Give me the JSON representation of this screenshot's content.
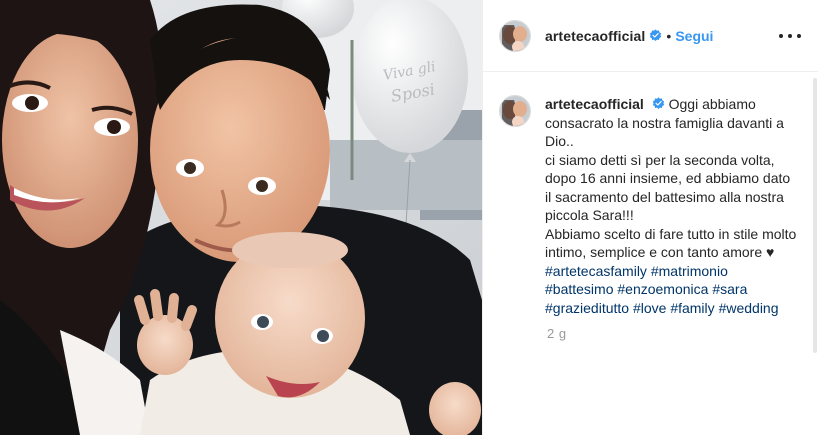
{
  "post": {
    "username": "artetecaofficial",
    "separator": "•",
    "follow_label": "Segui",
    "more_icon": "more-options-icon",
    "verified_color": "#3897f0",
    "caption": {
      "username": "artetecaofficial",
      "text": "Oggi abbiamo consacrato la nostra famiglia davanti a Dio..\nci siamo detti sì per la seconda volta, dopo 16 anni insieme, ed abbiamo dato il sacramento del battesimo alla nostra piccola Sara!!!\nAbbiamo scelto di fare tutto in stile molto intimo, semplice e con tanto amore ♥ ",
      "hashtags": [
        "#artetecasfamily",
        "#matrimonio",
        "#battesimo",
        "#enzoemonica",
        "#sara",
        "#grazieditutto",
        "#love",
        "#family",
        "#wedding"
      ]
    },
    "time_ago": "2 g",
    "balloon_text": "Viva gli Sposi"
  }
}
